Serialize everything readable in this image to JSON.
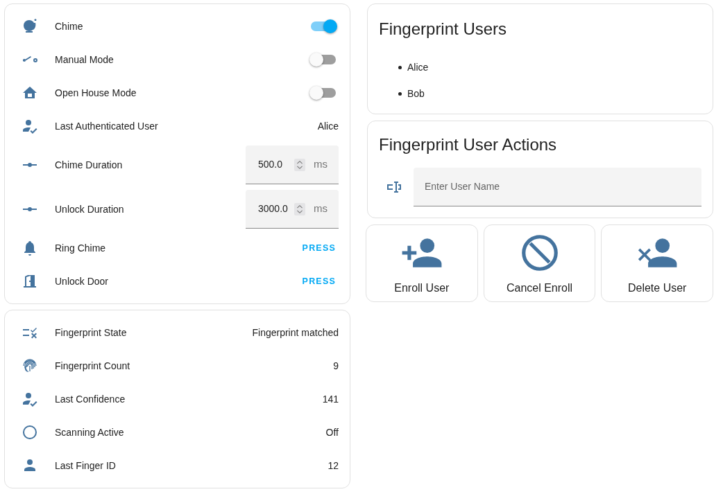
{
  "controls_card": {
    "rows": [
      {
        "kind": "toggle",
        "label": "Chime",
        "on": true
      },
      {
        "kind": "toggle",
        "label": "Manual Mode",
        "on": false
      },
      {
        "kind": "toggle",
        "label": "Open House Mode",
        "on": false
      },
      {
        "kind": "text",
        "label": "Last Authenticated User",
        "value": "Alice"
      },
      {
        "kind": "number",
        "label": "Chime Duration",
        "value": "500.0",
        "unit": "ms"
      },
      {
        "kind": "number",
        "label": "Unlock Duration",
        "value": "3000.0",
        "unit": "ms"
      },
      {
        "kind": "button",
        "label": "Ring Chime",
        "button": "PRESS"
      },
      {
        "kind": "button",
        "label": "Unlock Door",
        "button": "PRESS"
      }
    ]
  },
  "sensors_card": {
    "rows": [
      {
        "label": "Fingerprint State",
        "value": "Fingerprint matched"
      },
      {
        "label": "Fingerprint Count",
        "value": "9"
      },
      {
        "label": "Last Confidence",
        "value": "141"
      },
      {
        "label": "Scanning Active",
        "value": "Off"
      },
      {
        "label": "Last Finger ID",
        "value": "12"
      }
    ]
  },
  "users_card": {
    "title": "Fingerprint Users",
    "users": [
      "Alice",
      "Bob"
    ]
  },
  "actions_card": {
    "title": "Fingerprint User Actions",
    "input": {
      "placeholder": "Enter User Name"
    }
  },
  "action_buttons": [
    {
      "label": "Enroll User"
    },
    {
      "label": "Cancel Enroll"
    },
    {
      "label": "Delete User"
    }
  ]
}
